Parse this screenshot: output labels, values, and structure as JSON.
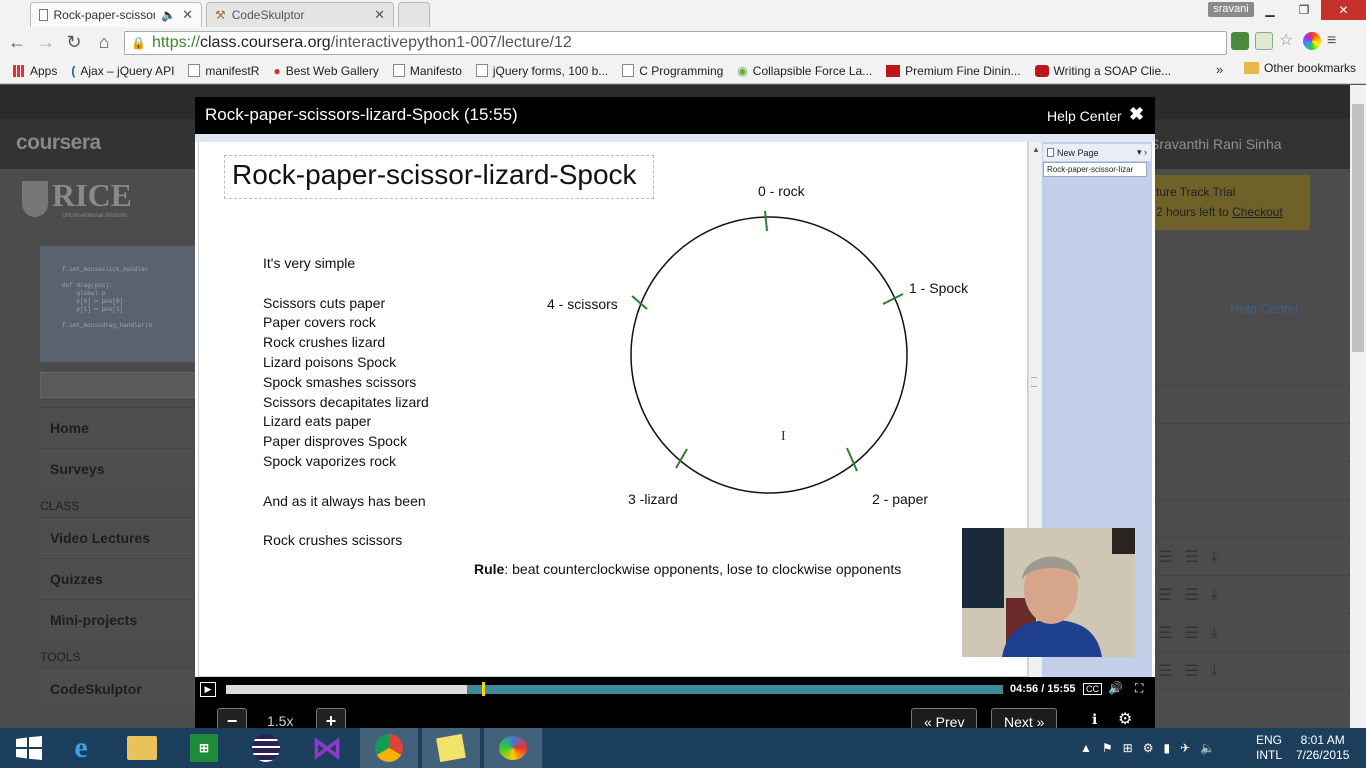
{
  "browser": {
    "tabs": [
      {
        "title": "Rock-paper-scissors-liz",
        "active": true
      },
      {
        "title": "CodeSkulptor",
        "active": false
      }
    ],
    "user_badge": "sravani",
    "url_prefix": "https://",
    "url_domain": "class.coursera.org",
    "url_path": "/interactivepython1-007/lecture/12",
    "bookmarks": [
      "Apps",
      "Ajax – jQuery API",
      "manifestR",
      "Best Web Gallery",
      "Manifesto",
      "jQuery forms, 100 b...",
      "C Programming",
      "Collapsible Force La...",
      "Premium Fine Dinin...",
      "Writing a SOAP Clie..."
    ],
    "bookmarks_more": "»",
    "other_bookmarks": "Other bookmarks"
  },
  "page": {
    "logo": "coursera",
    "university": "RICE",
    "university_sub": "Unconventional Wisdom",
    "user_name": "Sravanthi Rani Sinha",
    "trial_line1": "ture Track Trial",
    "trial_line2": "2 hours left to",
    "trial_link": "Checkout",
    "help_center": "Help Center",
    "nav_main": [
      "Home",
      "Surveys"
    ],
    "section_class": "CLASS",
    "nav_class": [
      "Video Lectures",
      "Quizzes",
      "Mini-projects"
    ],
    "section_tools": "TOOLS",
    "nav_tools": [
      "CodeSkulptor"
    ],
    "thumb_code": "f.set_mouseclick_handler\n\ndef drag(pos):\n    global p\n    p[0] = pos[0]\n    p[1] = pos[1]\n\nf.set_mousedrag_handler(d"
  },
  "modal": {
    "title": "Rock-paper-scissors-lizard-Spock (15:55)",
    "help_center": "Help Center",
    "close": "✖"
  },
  "slide": {
    "title": "Rock-paper-scissor-lizard-Spock",
    "intro": "It's very simple",
    "rules": [
      "Scissors cuts paper",
      "Paper covers rock",
      "Rock crushes lizard",
      "Lizard poisons Spock",
      "Spock smashes scissors",
      "Scissors decapitates lizard",
      "Lizard eats paper",
      "Paper disproves Spock",
      "Spock vaporizes rock"
    ],
    "outro": "And as it always has been",
    "final": "Rock crushes scissors",
    "rule_label": "Rule",
    "rule_text": ": beat counterclockwise opponents, lose to clockwise opponents",
    "diagram_labels": [
      "0 - rock",
      "1 - Spock",
      "2 - paper",
      "3 -lizard",
      "4 - scissors"
    ],
    "cursor": "I",
    "onenote_new_page": "New Page",
    "onenote_page_tab": "Rock-paper-scissor-lizar"
  },
  "player": {
    "current_time": "04:56",
    "total_time": "15:55",
    "time_label": "04:56 / 15:55",
    "progress_fraction": 0.31,
    "buffered_fraction": 0.33,
    "speed": "1.5x",
    "minus": "−",
    "plus": "+",
    "prev": "« Prev",
    "next": "Next »"
  },
  "taskbar": {
    "language_1": "ENG",
    "language_2": "INTL",
    "time": "8:01 AM",
    "date": "7/26/2015"
  },
  "colors": {
    "tick_green": "#2e7d32",
    "player_track": "#3f8a9a",
    "playhead": "#ffd400",
    "taskbar": "#1c3f5e"
  }
}
